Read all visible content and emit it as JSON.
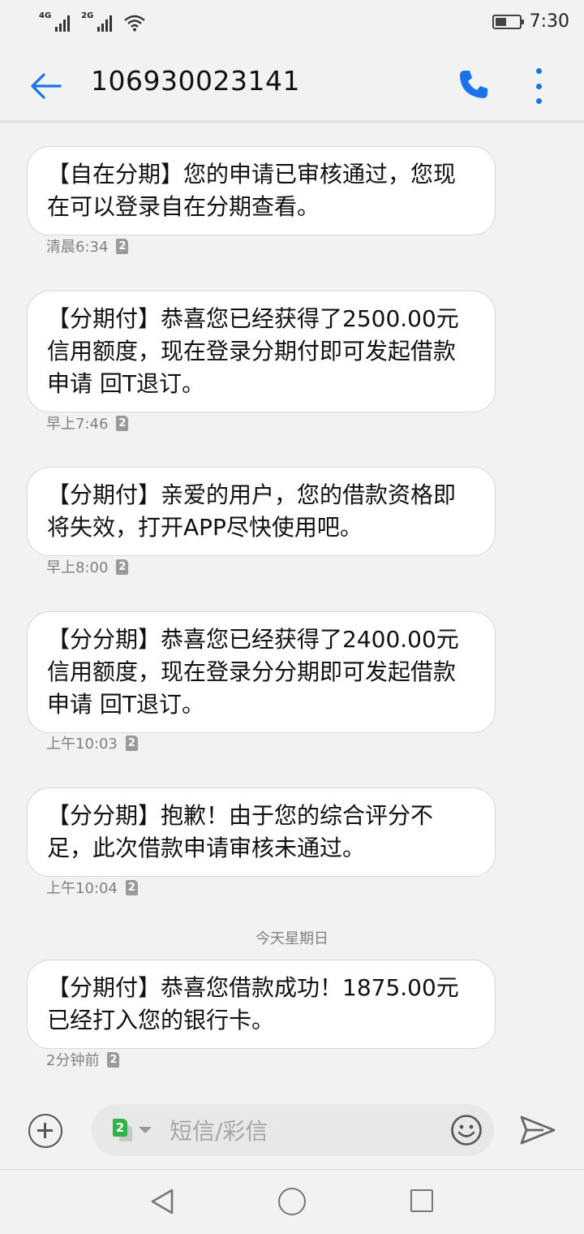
{
  "status": {
    "sim1_label": "4G",
    "sim2_label": "2G",
    "time": "7:30",
    "battery_level": 0.45
  },
  "header": {
    "title": "106930023141",
    "accent_color": "#1a73e8"
  },
  "messages": [
    {
      "text": "【自在分期】您的申请已审核通过，您现在可以登录自在分期查看。",
      "time": "清晨6:34",
      "sim": "2"
    },
    {
      "text": "【分期付】恭喜您已经获得了2500.00元信用额度，现在登录分期付即可发起借款申请 回T退订。",
      "time": "早上7:46",
      "sim": "2"
    },
    {
      "text": "【分期付】亲爱的用户，您的借款资格即将失效，打开APP尽快使用吧。",
      "time": "早上8:00",
      "sim": "2"
    },
    {
      "text": "【分分期】恭喜您已经获得了2400.00元信用额度，现在登录分分期即可发起借款申请 回T退订。",
      "time": "上午10:03",
      "sim": "2"
    },
    {
      "text": "【分分期】抱歉！由于您的综合评分不足，此次借款申请审核未通过。",
      "time": "上午10:04",
      "sim": "2"
    },
    {
      "text": "【分期付】恭喜您借款成功！1875.00元已经打入您的银行卡。",
      "time": "2分钟前",
      "sim": "2"
    }
  ],
  "date_separator": "今天星期日",
  "composer": {
    "sim_selected": "2",
    "placeholder": "短信/彩信"
  },
  "icons": {
    "back": "arrow-left-icon",
    "call": "phone-icon",
    "menu": "more-vert-icon",
    "add": "plus-circle-icon",
    "emoji": "smiley-icon",
    "send": "send-icon"
  }
}
